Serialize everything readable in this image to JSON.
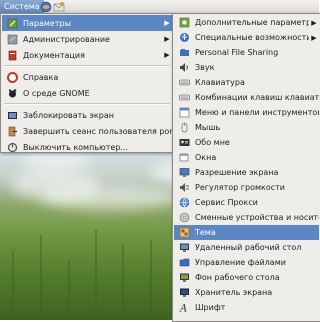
{
  "panel": {
    "menu_label": "Система"
  },
  "system_menu": {
    "items": [
      {
        "label": "Параметры",
        "icon": "preferences-icon",
        "submenu": true
      },
      {
        "label": "Администрирование",
        "icon": "administration-icon",
        "submenu": true
      },
      {
        "label": "Документация",
        "icon": "documentation-icon",
        "submenu": true
      },
      {
        "label": "Справка",
        "icon": "help-icon",
        "submenu": false
      },
      {
        "label": "О среде GNOME",
        "icon": "about-gnome-icon",
        "submenu": false
      },
      {
        "label": "Заблокировать экран",
        "icon": "lock-screen-icon",
        "submenu": false
      },
      {
        "label": "Завершить сеанс пользователя pomka...",
        "icon": "logout-icon",
        "submenu": false
      },
      {
        "label": "Выключить компьютер...",
        "icon": "shutdown-icon",
        "submenu": false
      }
    ],
    "selected": "Параметры"
  },
  "preferences_menu": {
    "items": [
      {
        "label": "Дополнительные параметры",
        "icon": "advanced-settings-icon",
        "submenu": true
      },
      {
        "label": "Специальные возможности",
        "icon": "accessibility-icon",
        "submenu": true
      },
      {
        "label": "Personal File Sharing",
        "icon": "file-sharing-icon",
        "submenu": false
      },
      {
        "label": "Звук",
        "icon": "sound-icon",
        "submenu": false
      },
      {
        "label": "Клавиатура",
        "icon": "keyboard-icon",
        "submenu": false
      },
      {
        "label": "Комбинации клавиш клавиатуры",
        "icon": "keyboard-shortcuts-icon",
        "submenu": false
      },
      {
        "label": "Меню и панели инструментов",
        "icon": "menus-toolbars-icon",
        "submenu": false
      },
      {
        "label": "Мышь",
        "icon": "mouse-icon",
        "submenu": false
      },
      {
        "label": "Обо мне",
        "icon": "about-me-icon",
        "submenu": false
      },
      {
        "label": "Окна",
        "icon": "windows-icon",
        "submenu": false
      },
      {
        "label": "Разрешение экрана",
        "icon": "screen-resolution-icon",
        "submenu": false
      },
      {
        "label": "Регулятор громкости",
        "icon": "volume-control-icon",
        "submenu": false
      },
      {
        "label": "Сервис Прокси",
        "icon": "proxy-icon",
        "submenu": false
      },
      {
        "label": "Сменные устройства и носители",
        "icon": "removable-media-icon",
        "submenu": false
      },
      {
        "label": "Тема",
        "icon": "theme-icon",
        "submenu": false
      },
      {
        "label": "Удаленный рабочий стол",
        "icon": "remote-desktop-icon",
        "submenu": false
      },
      {
        "label": "Управление файлами",
        "icon": "file-management-icon",
        "submenu": false
      },
      {
        "label": "Фон рабочего стола",
        "icon": "desktop-background-icon",
        "submenu": false
      },
      {
        "label": "Хранитель экрана",
        "icon": "screensaver-icon",
        "submenu": false
      },
      {
        "label": "Шрифт",
        "icon": "font-icon",
        "submenu": false
      }
    ],
    "selected": "Тема"
  },
  "colors": {
    "selection": "#5d86c4",
    "menu_bg": "#efedea"
  }
}
